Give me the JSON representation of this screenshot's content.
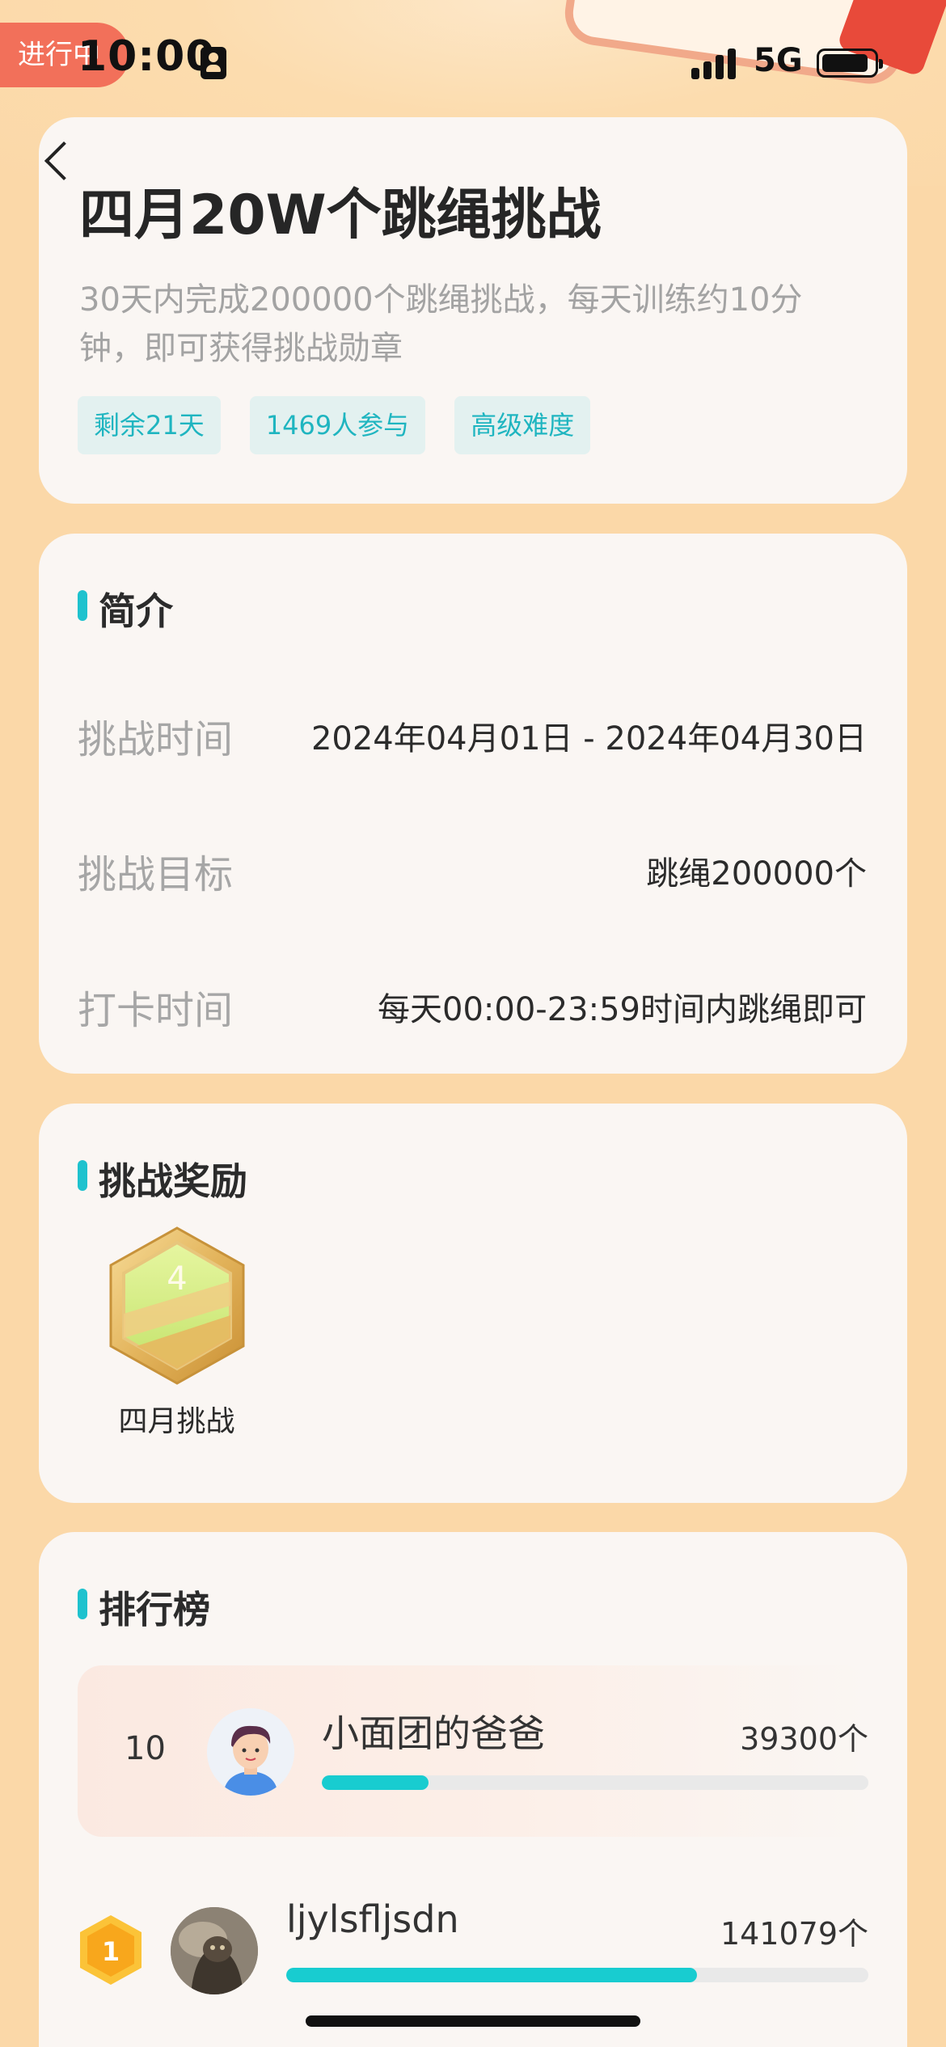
{
  "status_bar": {
    "tag": "进行中",
    "time": "10:00",
    "network": "5G"
  },
  "challenge": {
    "title": "四月20W个跳绳挑战",
    "description": "30天内完成200000个跳绳挑战，每天训练约10分钟，即可获得挑战勋章",
    "tags": [
      "剩余21天",
      "1469人参与",
      "高级难度"
    ]
  },
  "intro": {
    "section_title": "简介",
    "rows": [
      {
        "label": "挑战时间",
        "value": "2024年04月01日 - 2024年04月30日"
      },
      {
        "label": "挑战目标",
        "value": "跳绳200000个"
      },
      {
        "label": "打卡时间",
        "value": "每天00:00-23:59时间内跳绳即可"
      }
    ]
  },
  "reward": {
    "section_title": "挑战奖励",
    "badge_name": "四月挑战",
    "badge_numeral": "4"
  },
  "ranking": {
    "section_title": "排行榜",
    "me": {
      "rank": "10",
      "name": "小面团的爸爸",
      "count": "39300个",
      "progress": 0.196
    },
    "entries": [
      {
        "rank": "1",
        "name": "ljylsfljsdn",
        "count": "141079个",
        "progress": 0.705
      }
    ]
  },
  "colors": {
    "accent": "#1ec2ce",
    "background": "#fbd8a8",
    "card": "#faf6f3",
    "status_tag": "#f2705a"
  }
}
